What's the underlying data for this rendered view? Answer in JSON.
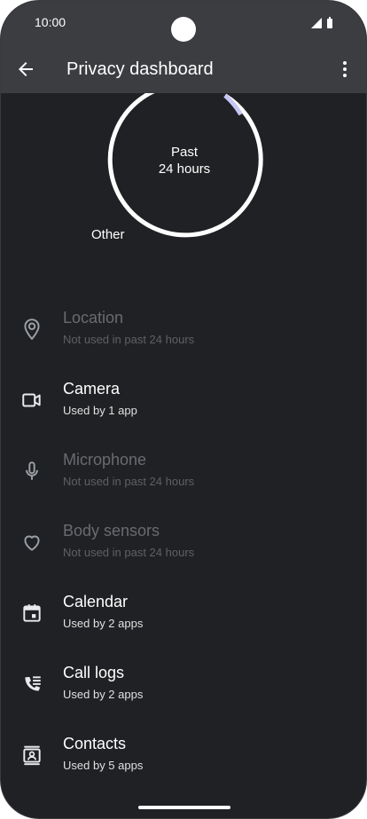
{
  "status_bar": {
    "time": "10:00"
  },
  "header": {
    "title": "Privacy dashboard"
  },
  "chart": {
    "center_line1": "Past",
    "center_line2": "24 hours",
    "other_label": "Other"
  },
  "permissions": [
    {
      "name": "Location",
      "status": "Not used in past 24 hours",
      "enabled": false,
      "icon": "location-icon"
    },
    {
      "name": "Camera",
      "status": "Used by 1 app",
      "enabled": true,
      "icon": "camera-icon"
    },
    {
      "name": "Microphone",
      "status": "Not used in past 24 hours",
      "enabled": false,
      "icon": "microphone-icon"
    },
    {
      "name": "Body sensors",
      "status": "Not used in past 24 hours",
      "enabled": false,
      "icon": "heart-icon"
    },
    {
      "name": "Calendar",
      "status": "Used by 2 apps",
      "enabled": true,
      "icon": "calendar-icon"
    },
    {
      "name": "Call logs",
      "status": "Used by 2 apps",
      "enabled": true,
      "icon": "call-log-icon"
    },
    {
      "name": "Contacts",
      "status": "Used by 5 apps",
      "enabled": true,
      "icon": "contacts-icon"
    }
  ]
}
